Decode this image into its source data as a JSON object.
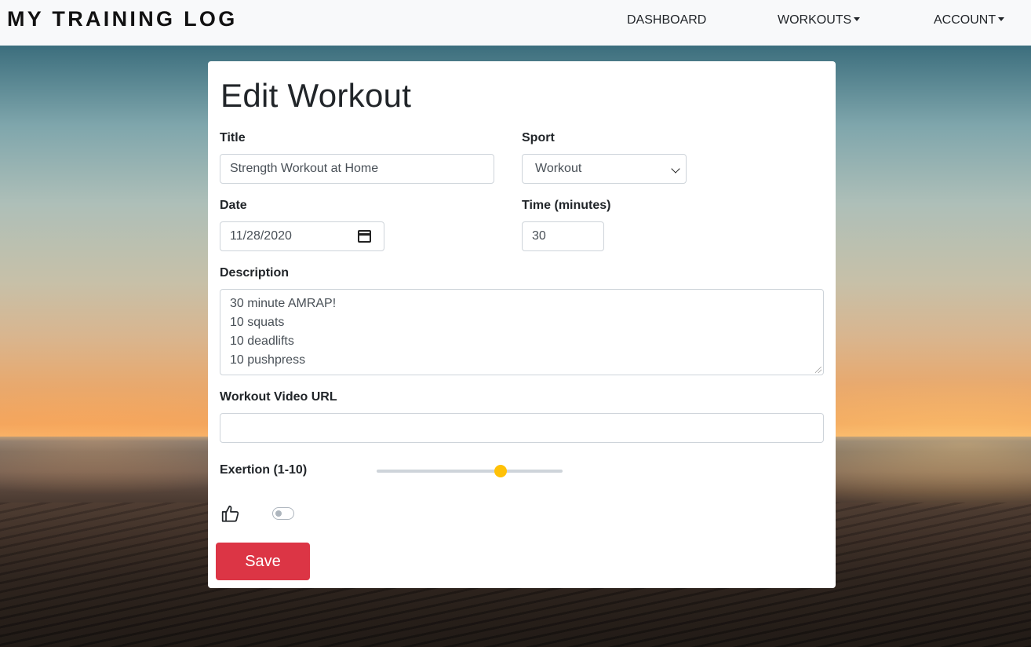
{
  "navbar": {
    "brand": "MY TRAINING LOG",
    "items": [
      {
        "label": "DASHBOARD",
        "dropdown": false
      },
      {
        "label": "WORKOUTS",
        "dropdown": true
      },
      {
        "label": "ACCOUNT",
        "dropdown": true
      }
    ]
  },
  "form": {
    "heading": "Edit Workout",
    "title_label": "Title",
    "title_value": "Strength Workout at Home",
    "sport_label": "Sport",
    "sport_value": "Workout",
    "date_label": "Date",
    "date_value": "11/28/2020",
    "time_label": "Time (minutes)",
    "time_value": "30",
    "description_label": "Description",
    "description_lines": [
      "30 minute AMRAP!",
      "10 squats",
      "10 deadlifts",
      "10 pushpress"
    ],
    "video_label": "Workout Video URL",
    "video_value": "",
    "exertion_label": "Exertion (1-10)",
    "exertion_value": 7,
    "exertion_min": 1,
    "exertion_max": 10,
    "like_toggle_on": false,
    "save_label": "Save"
  },
  "colors": {
    "accent_save": "#dc3545",
    "range_thumb": "#ffc107",
    "navbar_bg": "#f8f9fa"
  },
  "icons": {
    "like": "thumbs-up-icon",
    "calendar": "calendar-icon",
    "dropdown": "caret-down-icon"
  }
}
